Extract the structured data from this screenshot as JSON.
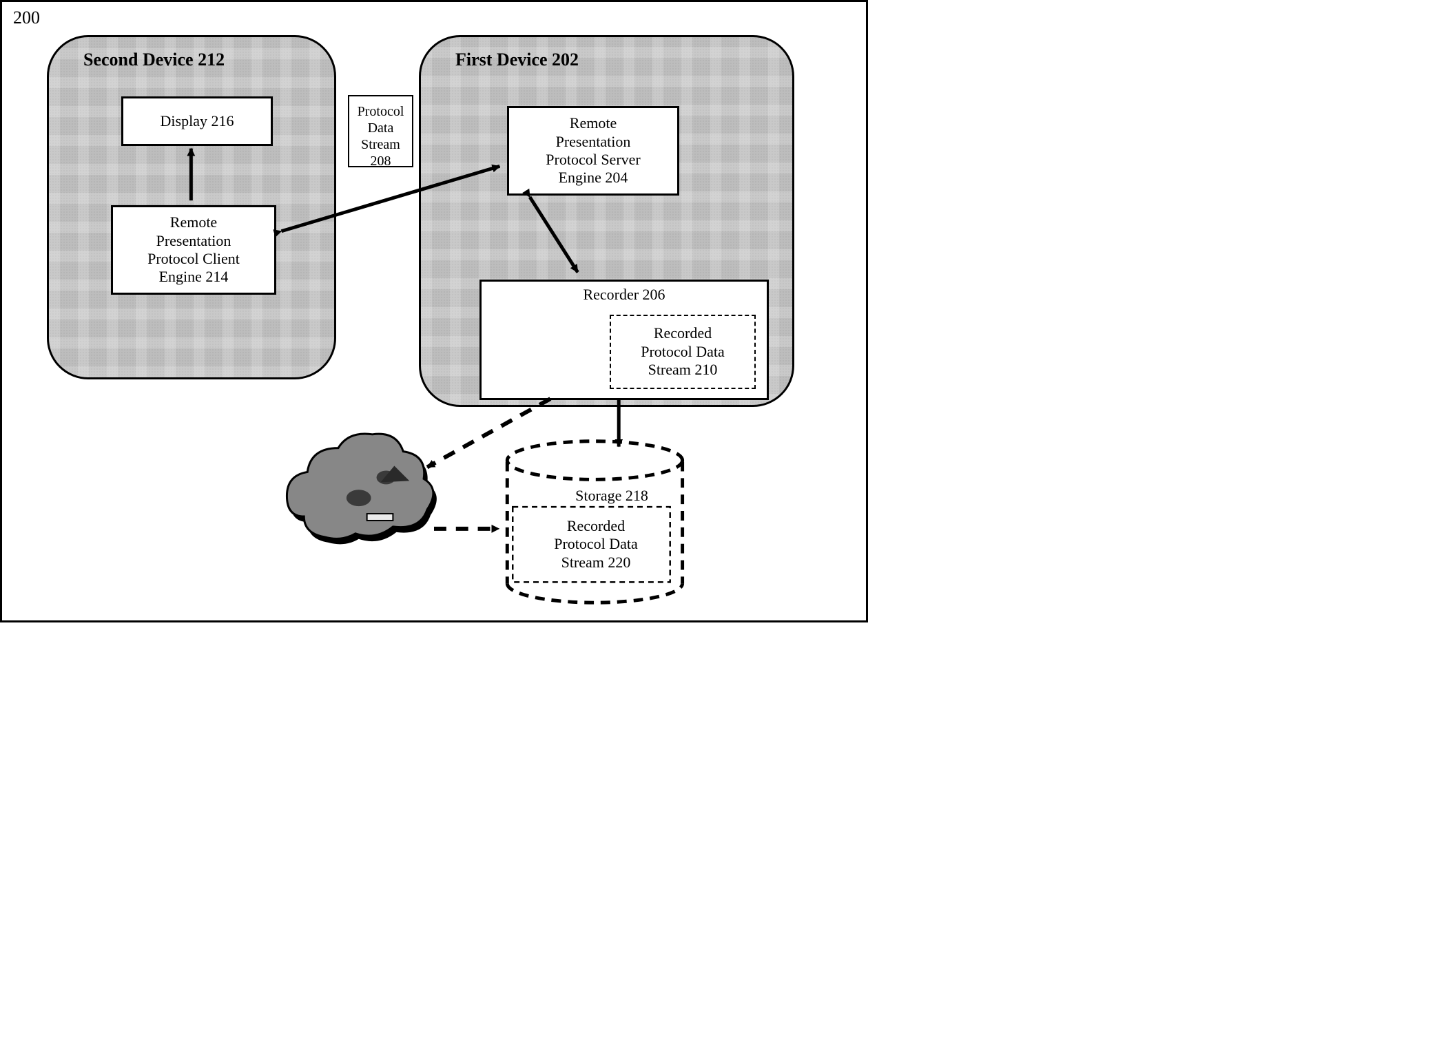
{
  "figure_number": "200",
  "second_device": {
    "title": "Second Device 212",
    "display_label": "Display 216",
    "client_engine_label": "Remote\nPresentation\nProtocol Client\nEngine 214"
  },
  "protocol_data_stream_label": "Protocol\nData\nStream\n208",
  "first_device": {
    "title": "First Device 202",
    "server_engine_label": "Remote\nPresentation\nProtocol Server\nEngine 204",
    "recorder_label": "Recorder 206",
    "recorded_stream_label": "Recorded\nProtocol Data\nStream 210"
  },
  "storage": {
    "storage_label": "Storage 218",
    "recorded_stream_label": "Recorded\nProtocol Data\nStream 220"
  }
}
